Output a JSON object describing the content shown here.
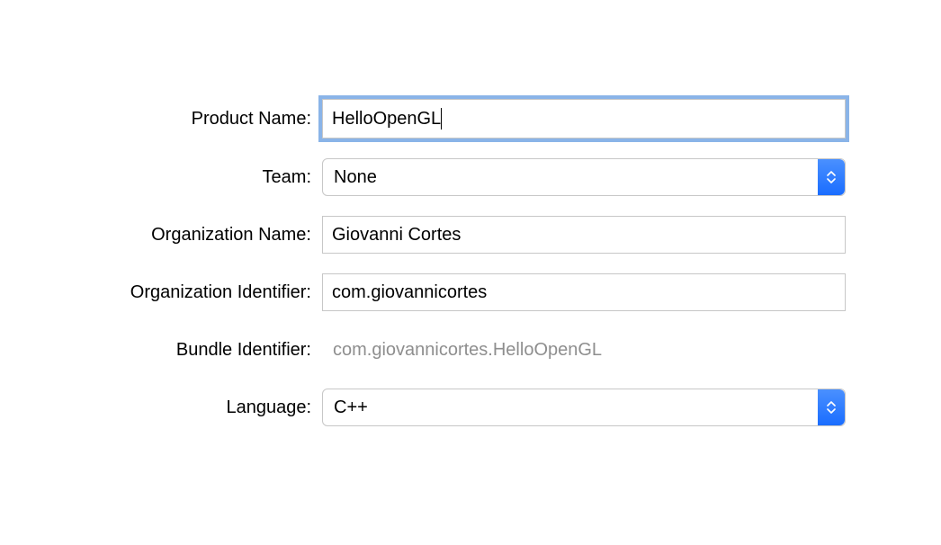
{
  "form": {
    "productName": {
      "label": "Product Name:",
      "value": "HelloOpenGL"
    },
    "team": {
      "label": "Team:",
      "value": "None"
    },
    "organizationName": {
      "label": "Organization Name:",
      "value": "Giovanni Cortes"
    },
    "organizationIdentifier": {
      "label": "Organization Identifier:",
      "value": "com.giovannicortes"
    },
    "bundleIdentifier": {
      "label": "Bundle Identifier:",
      "value": "com.giovannicortes.HelloOpenGL"
    },
    "language": {
      "label": "Language:",
      "value": "C++"
    }
  }
}
